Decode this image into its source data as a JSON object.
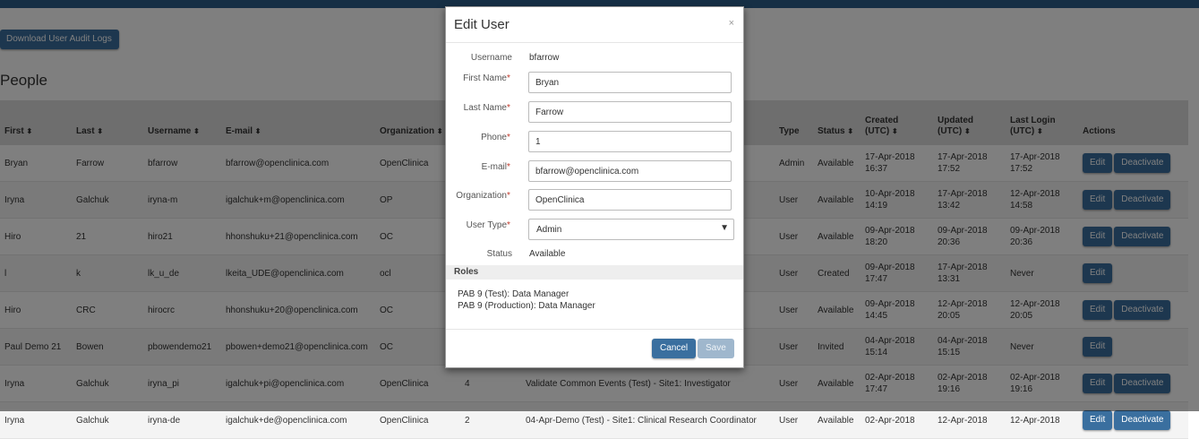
{
  "page": {
    "download_button": "Download User Audit Logs",
    "title": "People"
  },
  "table": {
    "headers": {
      "first": "First",
      "last": "Last",
      "username": "Username",
      "email": "E-mail",
      "organization": "Organization",
      "type": "Type",
      "status": "Status",
      "created": [
        "Created",
        "(UTC)"
      ],
      "updated": [
        "Updated",
        "(UTC)"
      ],
      "last_login": [
        "Last Login",
        "(UTC)"
      ],
      "actions": "Actions"
    },
    "sort_icon": "sort-icon",
    "rows": [
      {
        "first": "Bryan",
        "last": "Farrow",
        "username": "bfarrow",
        "email": "bfarrow@openclinica.com",
        "org": "OpenClinica",
        "count": "",
        "roles": "",
        "type": "Admin",
        "status": "Available",
        "created": [
          "17-Apr-2018",
          "16:37"
        ],
        "updated": [
          "17-Apr-2018",
          "17:52"
        ],
        "login": [
          "17-Apr-2018",
          "17:52"
        ],
        "actions": [
          "Edit",
          "Deactivate"
        ]
      },
      {
        "first": "Iryna",
        "last": "Galchuk",
        "username": "iryna-m",
        "email": "igalchuk+m@openclinica.com",
        "org": "OP",
        "count": "",
        "roles": "",
        "type": "User",
        "status": "Available",
        "created": [
          "10-Apr-2018",
          "14:19"
        ],
        "updated": [
          "17-Apr-2018",
          "13:42"
        ],
        "login": [
          "12-Apr-2018",
          "14:58"
        ],
        "actions": [
          "Edit",
          "Deactivate"
        ]
      },
      {
        "first": "Hiro",
        "last": "21",
        "username": "hiro21",
        "email": "hhonshuku+21@openclinica.com",
        "org": "OC",
        "count": "",
        "roles": "",
        "type": "User",
        "status": "Available",
        "created": [
          "09-Apr-2018",
          "18:20"
        ],
        "updated": [
          "09-Apr-2018",
          "20:36"
        ],
        "login": [
          "09-Apr-2018",
          "20:36"
        ],
        "actions": [
          "Edit",
          "Deactivate"
        ]
      },
      {
        "first": "l",
        "last": "k",
        "username": "lk_u_de",
        "email": "lkeita_UDE@openclinica.com",
        "org": "ocl",
        "count": "",
        "roles": "",
        "type": "User",
        "status": "Created",
        "created": [
          "09-Apr-2018",
          "17:47"
        ],
        "updated": [
          "17-Apr-2018",
          "13:31"
        ],
        "login": [
          "Never",
          ""
        ],
        "actions": [
          "Edit"
        ]
      },
      {
        "first": "Hiro",
        "last": "CRC",
        "username": "hirocrc",
        "email": "hhonshuku+20@openclinica.com",
        "org": "OC",
        "count": "",
        "roles": "",
        "type": "User",
        "status": "Available",
        "created": [
          "09-Apr-2018",
          "14:45"
        ],
        "updated": [
          "12-Apr-2018",
          "20:05"
        ],
        "login": [
          "12-Apr-2018",
          "20:05"
        ],
        "actions": [
          "Edit",
          "Deactivate"
        ]
      },
      {
        "first": "Paul Demo 21",
        "last": "Bowen",
        "username": "pbowendemo21",
        "email": "pbowen+demo21@openclinica.com",
        "org": "OC",
        "count": "",
        "roles": "",
        "type": "User",
        "status": "Invited",
        "created": [
          "04-Apr-2018",
          "15:14"
        ],
        "updated": [
          "04-Apr-2018",
          "15:15"
        ],
        "login": [
          "Never",
          ""
        ],
        "actions": [
          "Edit"
        ]
      },
      {
        "first": "Iryna",
        "last": "Galchuk",
        "username": "iryna_pi",
        "email": "igalchuk+pi@openclinica.com",
        "org": "OpenClinica",
        "count": "4",
        "roles": "Validate Common Events (Test) - Site1: Investigator",
        "type": "User",
        "status": "Available",
        "created": [
          "02-Apr-2018",
          "17:47"
        ],
        "updated": [
          "02-Apr-2018",
          "19:16"
        ],
        "login": [
          "02-Apr-2018",
          "19:16"
        ],
        "actions": [
          "Edit",
          "Deactivate"
        ]
      },
      {
        "first": "Iryna",
        "last": "Galchuk",
        "username": "iryna-de",
        "email": "igalchuk+de@openclinica.com",
        "org": "OpenClinica",
        "count": "2",
        "roles": "04-Apr-Demo (Test) - Site1: Clinical Research Coordinator",
        "type": "User",
        "status": "Available",
        "created": [
          "02-Apr-2018",
          ""
        ],
        "updated": [
          "12-Apr-2018",
          ""
        ],
        "login": [
          "12-Apr-2018",
          ""
        ],
        "actions": [
          "Edit",
          "Deactivate"
        ]
      }
    ]
  },
  "modal": {
    "title": "Edit User",
    "close": "×",
    "fields": {
      "username": {
        "label": "Username",
        "value": "bfarrow"
      },
      "first_name": {
        "label": "First Name",
        "value": "Bryan"
      },
      "last_name": {
        "label": "Last Name",
        "value": "Farrow"
      },
      "phone": {
        "label": "Phone",
        "value": "1"
      },
      "email": {
        "label": "E-mail",
        "value": "bfarrow@openclinica.com"
      },
      "organization": {
        "label": "Organization",
        "value": "OpenClinica"
      },
      "user_type": {
        "label": "User Type",
        "value": "Admin"
      },
      "status": {
        "label": "Status",
        "value": "Available"
      }
    },
    "required_mark": "*",
    "roles_title": "Roles",
    "roles": [
      "PAB 9 (Test): Data Manager",
      "PAB 9 (Production): Data Manager"
    ],
    "cancel": "Cancel",
    "save": "Save",
    "dropdown_icon": "▼"
  },
  "colors": {
    "brand": "#2c5f8a",
    "button": "#3a6f9f",
    "button_disabled": "#9fb7cd",
    "required": "#c0392b"
  }
}
